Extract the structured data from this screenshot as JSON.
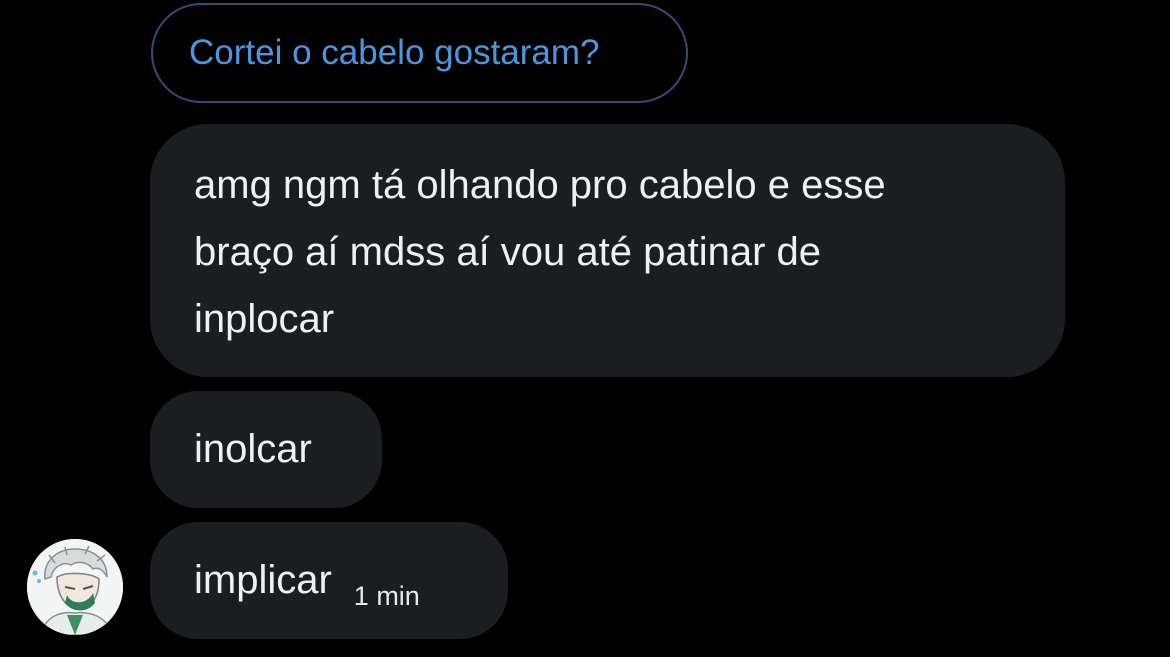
{
  "conversation": {
    "reply_to": {
      "text": "Cortei o cabelo gostaram?"
    },
    "messages": [
      {
        "lines": [
          "amg ngm tá olhando pro cabelo e esse",
          "braço aí mdss aí vou até patinar de",
          "inplocar"
        ]
      },
      {
        "text": "inolcar"
      },
      {
        "text": "implicar",
        "timestamp": "1 min"
      }
    ]
  },
  "sender": {
    "avatar_icon": "anime-character-avatar"
  },
  "colors": {
    "background": "#000000",
    "bubble": "#1c1d20",
    "reply_border": "#2f4e73",
    "reply_text": "#4a97e0",
    "message_text": "#eef0f1"
  }
}
